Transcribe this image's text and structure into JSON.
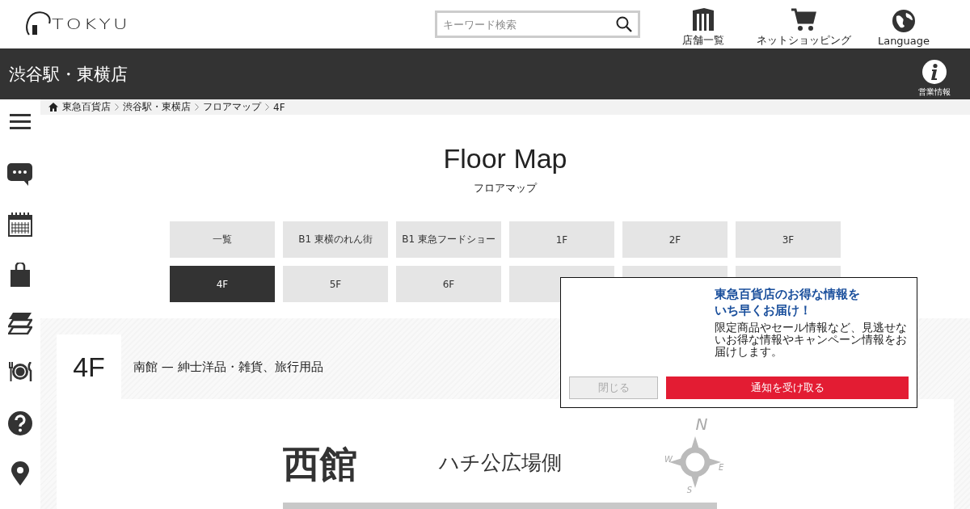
{
  "header": {
    "logo_text": "TOKYU",
    "search": {
      "placeholder": "キーワード検索"
    },
    "links": [
      {
        "label": "店舗一覧"
      },
      {
        "label": "ネットショッピング"
      },
      {
        "label": "Language"
      }
    ]
  },
  "store_bar": {
    "title": "渋谷駅・東横店",
    "info_label": "営業情報"
  },
  "breadcrumb": [
    "東急百貨店",
    "渋谷駅・東横店",
    "フロアマップ",
    "4F"
  ],
  "page_title": "Floor Map",
  "page_subtitle": "フロアマップ",
  "floors": [
    {
      "label": "一覧",
      "selected": false
    },
    {
      "label": "B1 東横のれん街",
      "selected": false
    },
    {
      "label": "B1 東急フードショー",
      "selected": false
    },
    {
      "label": "1F",
      "selected": false
    },
    {
      "label": "2F",
      "selected": false
    },
    {
      "label": "3F",
      "selected": false
    },
    {
      "label": "4F",
      "selected": true
    },
    {
      "label": "5F",
      "selected": false
    },
    {
      "label": "6F",
      "selected": false
    },
    {
      "selected": false
    },
    {
      "selected": false
    },
    {
      "selected": false
    }
  ],
  "floor_section": {
    "floor": "4F",
    "description": "南館 — 紳士洋品・雑貨、旅行用品"
  },
  "map": {
    "building": "西館",
    "side": "ハチ公広場側",
    "compass": [
      "N",
      "E",
      "S",
      "W"
    ]
  },
  "popup": {
    "title_lines": [
      "東急百貨店のお得な情報を",
      "いち早くお届け！"
    ],
    "body": "限定商品やセール情報など、見逃せないお得な情報やキャンペーン情報をお届けします。",
    "close_button": "閉じる",
    "accept_button": "通知を受け取る"
  }
}
